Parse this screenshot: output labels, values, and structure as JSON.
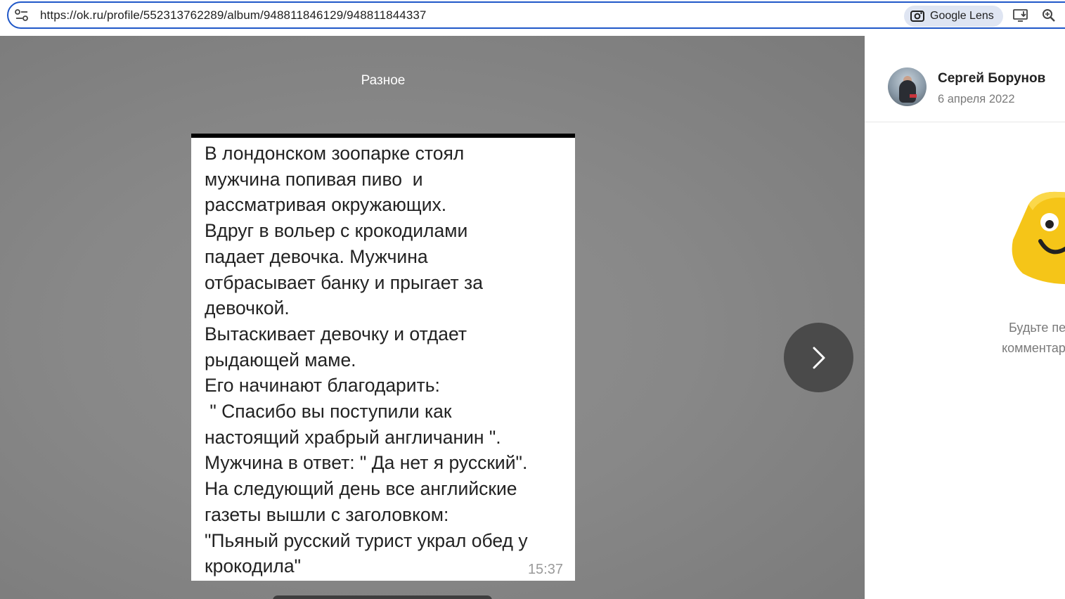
{
  "browser": {
    "url": "https://ok.ru/profile/552313762289/album/948811846129/948811844337",
    "lens_label": "Google Lens",
    "icons": [
      "tune-icon",
      "google-lens-icon",
      "install-app-icon",
      "zoom-icon"
    ]
  },
  "viewer": {
    "album_title": "Разное",
    "photo_text": "В лондонском зоопарке стоял\nмужчина попивая пиво  и\nрассматривая окружающих.\nВдруг в вольер с крокодилами\nпадает девочка. Мужчина\nотбрасывает банку и прыгает за\nдевочкой.\nВытаскивает девочку и отдает\nрыдающей маме.\nЕго начинают благодарить:\n \" Спасибо вы поступили как\nнастоящий храбрый англичанин \".\nМужчина в ответ: \" Да нет я русский\".\nНа следующий день все английские\nгазеты вышли с заголовком:\n\"Пьяный русский турист украл обед у\nкрокодила\"",
    "photo_time": "15:37",
    "next_icon": "chevron-right-icon"
  },
  "side_panel": {
    "author_name": "Сергей Борунов",
    "date": "6 апреля 2022",
    "empty_comments_line1": "Будьте первым",
    "empty_comments_line2": "комментарий к эт",
    "mascot_color": "#f5c518"
  }
}
